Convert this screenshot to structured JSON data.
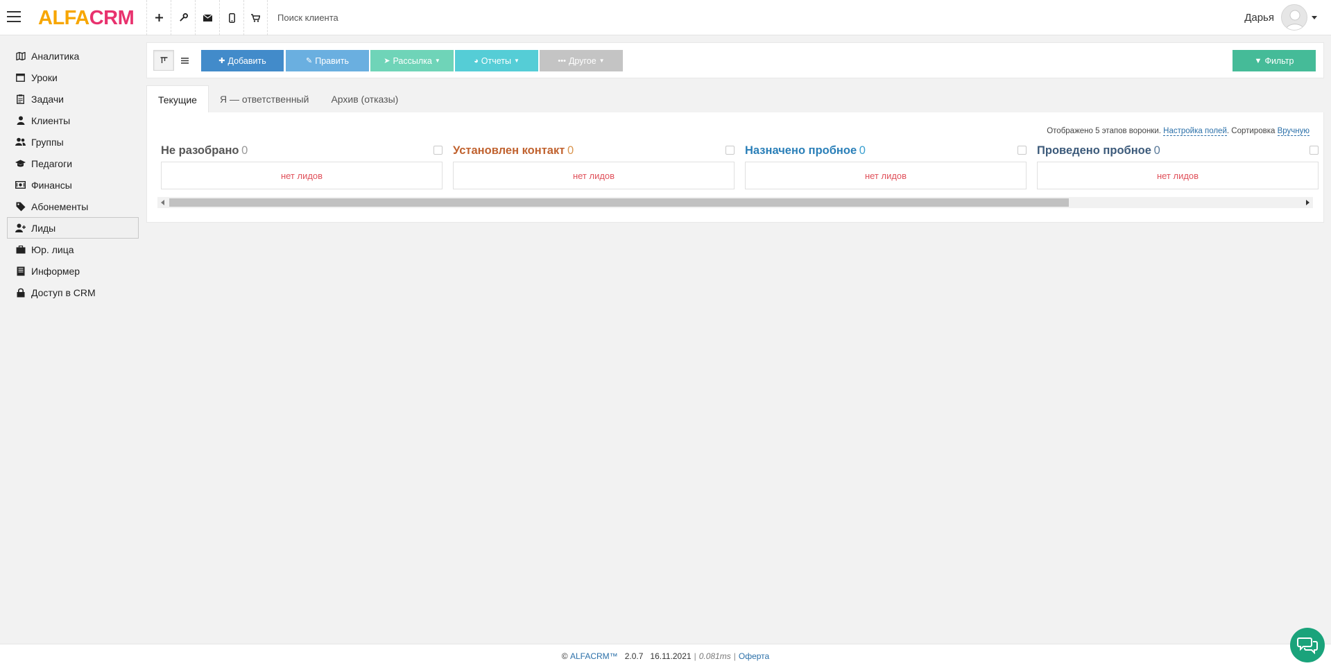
{
  "brand": {
    "part1": "ALFA",
    "part2": "CRM",
    "color1": "#f7a600",
    "color2": "#e8326e"
  },
  "topbar": {
    "icons": [
      "plus-icon",
      "wrench-icon",
      "mail-icon",
      "mobile-icon",
      "cart-icon"
    ],
    "search_placeholder": "Поиск клиента",
    "user_name": "Дарья"
  },
  "sidebar": {
    "items": [
      {
        "label": "Аналитика",
        "icon": "map-icon"
      },
      {
        "label": "Уроки",
        "icon": "calendar-icon"
      },
      {
        "label": "Задачи",
        "icon": "clipboard-icon"
      },
      {
        "label": "Клиенты",
        "icon": "user-icon"
      },
      {
        "label": "Группы",
        "icon": "users-icon"
      },
      {
        "label": "Педагоги",
        "icon": "graduation-cap-icon"
      },
      {
        "label": "Финансы",
        "icon": "money-icon"
      },
      {
        "label": "Абонементы",
        "icon": "tags-icon"
      },
      {
        "label": "Лиды",
        "icon": "user-plus-icon",
        "active": true
      },
      {
        "label": "Юр. лица",
        "icon": "briefcase-icon"
      },
      {
        "label": "Информер",
        "icon": "book-icon"
      },
      {
        "label": "Доступ в CRM",
        "icon": "lock-icon"
      }
    ]
  },
  "toolbar": {
    "add": "Добавить",
    "edit": "Править",
    "mailing": "Рассылка",
    "reports": "Отчеты",
    "other": "Другое",
    "filter": "Фильтр",
    "colors": {
      "add": "#428bca",
      "edit": "#6aafe0",
      "mailing": "#6fd4b8",
      "reports": "#55cdd6",
      "other": "#c4c4c4",
      "filter": "#45bb98"
    }
  },
  "tabs": [
    "Текущие",
    "Я — ответственный",
    "Архив (отказы)"
  ],
  "funnel": {
    "info_prefix": "Отображено 5 этапов воронки.",
    "settings_link": "Настройка полей",
    "sort_label": ". Сортировка",
    "sort_value": "Вручную",
    "empty_text": "нет лидов",
    "stages": [
      {
        "title": "Не разобрано",
        "count": "0",
        "color": "#555555",
        "count_color": "#999999"
      },
      {
        "title": "Установлен контакт",
        "count": "0",
        "color": "#c0622f",
        "count_color": "#d9954f"
      },
      {
        "title": "Назначено пробное",
        "count": "0",
        "color": "#2a7fb8",
        "count_color": "#3aa0d0"
      },
      {
        "title": "Проведено пробное",
        "count": "0",
        "color": "#3c5a7a",
        "count_color": "#5a7a9a"
      }
    ]
  },
  "footer": {
    "copyright": "©",
    "brand_link": "ALFACRM™",
    "version": "2.0.7",
    "date": "16.11.2021",
    "sep": "|",
    "timing": "0.081ms",
    "offer": "Оферта"
  }
}
